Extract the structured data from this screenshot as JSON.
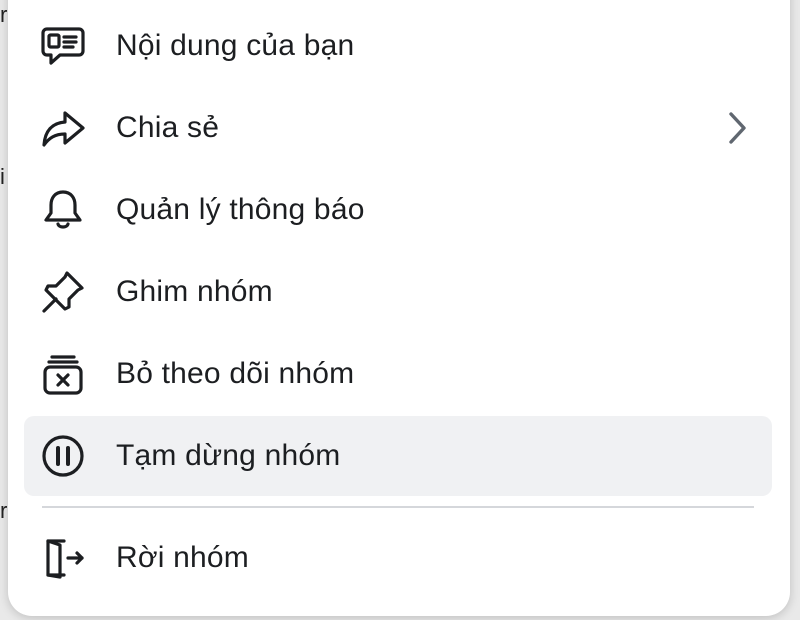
{
  "menu": {
    "items": [
      {
        "label": "Nội dung của bạn",
        "icon": "content-icon"
      },
      {
        "label": "Chia sẻ",
        "icon": "share-icon",
        "has_submenu": true
      },
      {
        "label": "Quản lý thông báo",
        "icon": "bell-icon"
      },
      {
        "label": "Ghim nhóm",
        "icon": "pin-icon"
      },
      {
        "label": "Bỏ theo dõi nhóm",
        "icon": "unfollow-icon"
      },
      {
        "label": "Tạm dừng nhóm",
        "icon": "pause-icon",
        "highlighted": true
      },
      {
        "label": "Rời nhóm",
        "icon": "leave-icon"
      }
    ]
  },
  "colors": {
    "text": "#1c1e21",
    "highlight": "#f0f1f3",
    "divider": "#d5d7db",
    "icon": "#1c1e21",
    "chevron": "#606770"
  }
}
